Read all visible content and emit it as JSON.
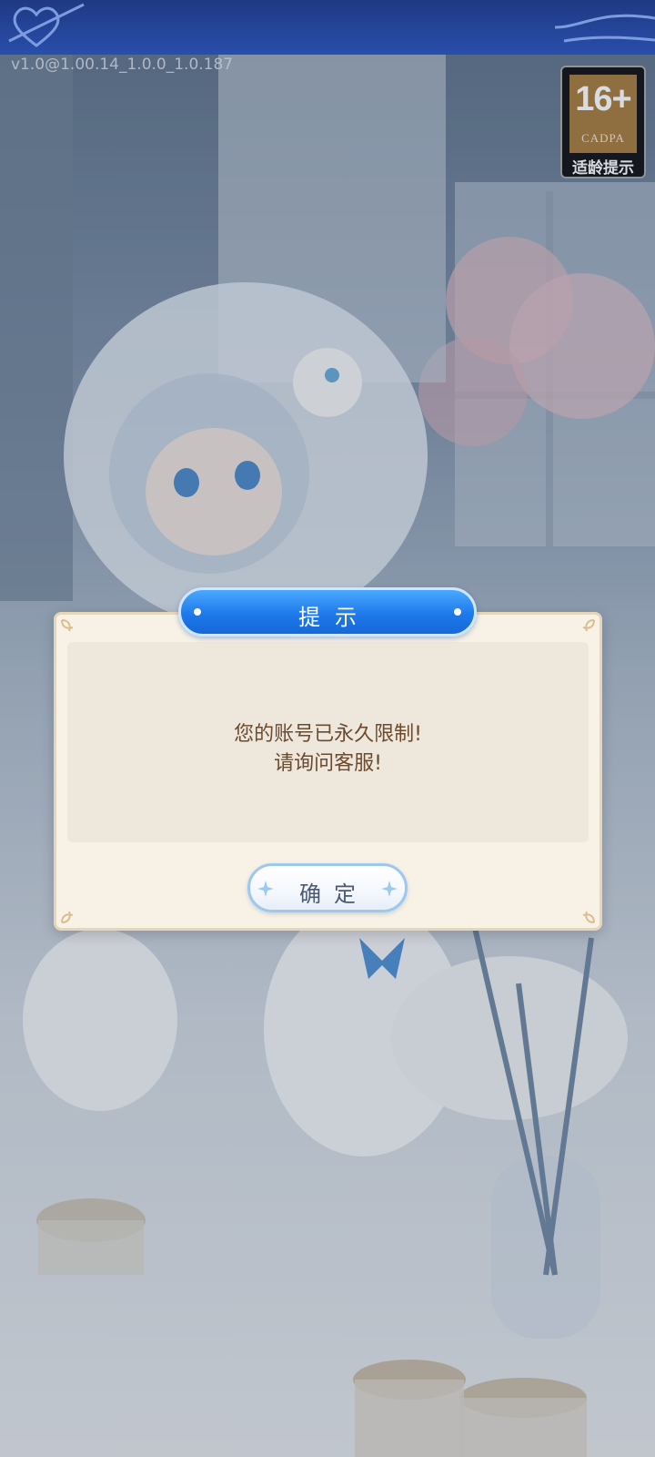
{
  "app": {
    "version": "v1.0@1.00.14_1.0.0_1.0.187"
  },
  "age_rating": {
    "age": "16+",
    "org": "CADPA",
    "tip": "适龄提示"
  },
  "dialog": {
    "title": "提示",
    "message_line1": "您的账号已永久限制!",
    "message_line2": "请询问客服!",
    "confirm_label": "确定"
  },
  "colors": {
    "title_blue": "#1e79ea",
    "dialog_bg": "#f7f1e6",
    "message_brown": "#6b4a2e",
    "badge_gold": "#a67b3d"
  },
  "icons": [
    "heart-logo-icon",
    "cloud-deco-icon",
    "corner-ornament-icon",
    "sparkle-icon"
  ]
}
